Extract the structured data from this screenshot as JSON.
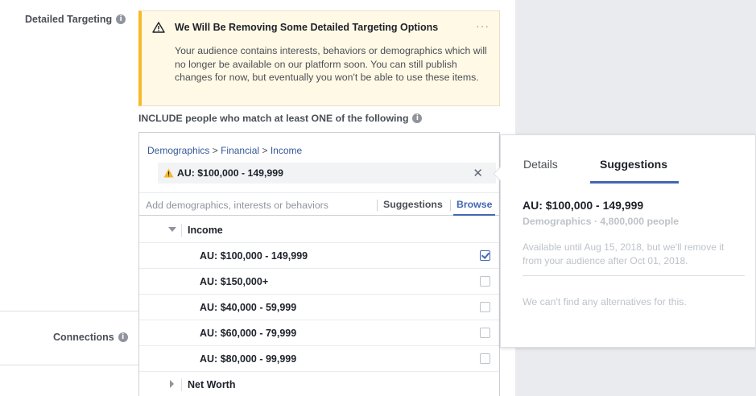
{
  "labels": {
    "detailed_targeting": "Detailed Targeting",
    "connections": "Connections",
    "info_glyph": "i"
  },
  "warning": {
    "title": "We Will Be Removing Some Detailed Targeting Options",
    "more": "···",
    "body": "Your audience contains interests, behaviors or demographics which will no longer be available on our platform soon. You can still publish changes for now, but eventually you won't be able to use these items."
  },
  "include_text": "INCLUDE people who match at least ONE of the following",
  "breadcrumb": {
    "part1": "Demographics",
    "sep": ">",
    "part2": "Financial",
    "part3": "Income"
  },
  "selected_item": {
    "label": "AU: $100,000 - 149,999",
    "close": "✕"
  },
  "search": {
    "placeholder": "Add demographics, interests or behaviors",
    "suggestions_label": "Suggestions",
    "browse_label": "Browse"
  },
  "dropdown": {
    "group_income": "Income",
    "options": [
      {
        "label": "AU: $100,000 - 149,999",
        "checked": true
      },
      {
        "label": "AU: $150,000+",
        "checked": false
      },
      {
        "label": "AU: $40,000 - 59,999",
        "checked": false
      },
      {
        "label": "AU: $60,000 - 79,999",
        "checked": false
      },
      {
        "label": "AU: $80,000 - 99,999",
        "checked": false
      }
    ],
    "group_networth": "Net Worth"
  },
  "panel": {
    "tab_details": "Details",
    "tab_suggestions": "Suggestions",
    "title": "AU: $100,000 - 149,999",
    "subtitle": "Demographics · 4,800,000 people",
    "note": "Available until Aug 15, 2018, but we'll remove it from your audience after Oct 01, 2018.",
    "empty": "We can't find any alternatives for this."
  },
  "colors": {
    "accent": "#4267b2",
    "warning_bar": "#f7b928",
    "warning_bg": "#fff9e5",
    "page_gray": "#e9ebee"
  }
}
